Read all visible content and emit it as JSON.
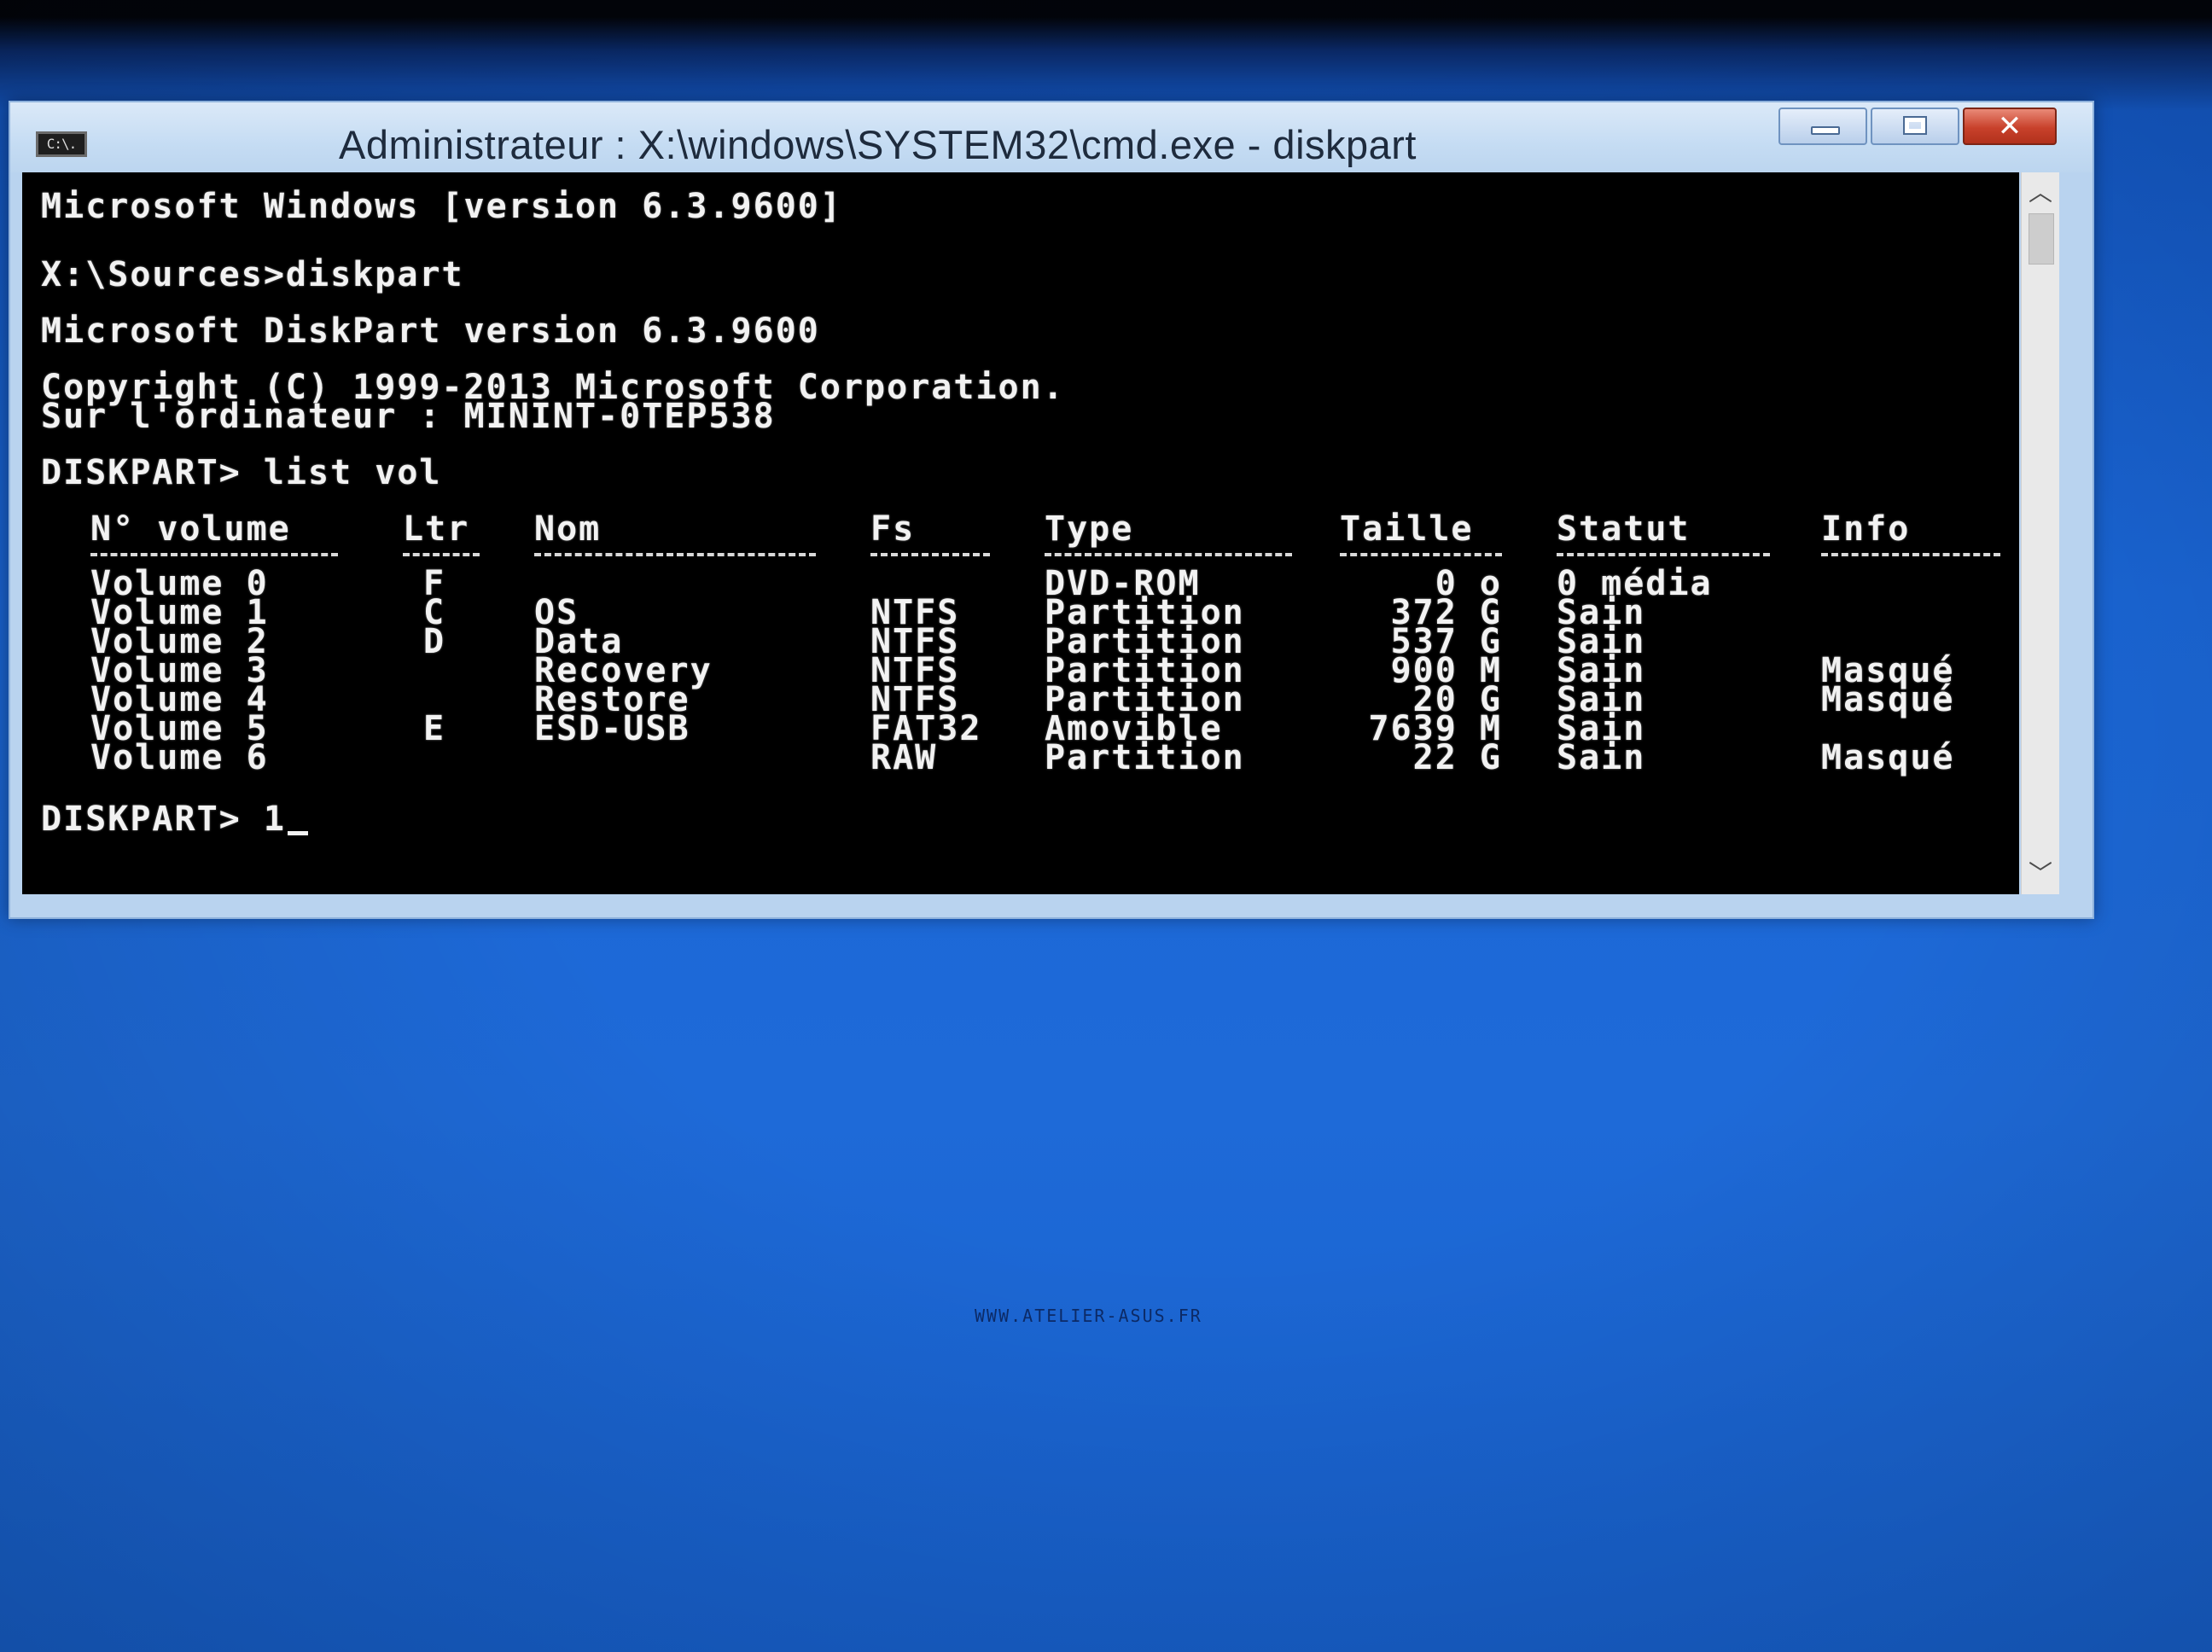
{
  "window": {
    "title": "Administrateur : X:\\windows\\SYSTEM32\\cmd.exe - diskpart",
    "icon_label": "C:\\."
  },
  "console": {
    "lines": [
      "Microsoft Windows [version 6.3.9600]",
      "X:\\Sources>diskpart",
      "Microsoft DiskPart version 6.3.9600",
      "Copyright (C) 1999-2013 Microsoft Corporation.",
      "Sur l'ordinateur : MININT-0TEP538",
      "DISKPART> list vol"
    ],
    "prompt": "DISKPART> ",
    "current_input": "1"
  },
  "volume_table": {
    "headers": [
      "N° volume",
      "Ltr",
      "Nom",
      "Fs",
      "Type",
      "Taille",
      "Statut",
      "Info"
    ],
    "rows": [
      {
        "volume": "Volume 0",
        "ltr": "F",
        "nom": "",
        "fs": "",
        "type": "DVD-ROM",
        "taille": "0 o",
        "statut": "0 média",
        "info": ""
      },
      {
        "volume": "Volume 1",
        "ltr": "C",
        "nom": "OS",
        "fs": "NTFS",
        "type": "Partition",
        "taille": "372 G",
        "statut": "Sain",
        "info": ""
      },
      {
        "volume": "Volume 2",
        "ltr": "D",
        "nom": "Data",
        "fs": "NTFS",
        "type": "Partition",
        "taille": "537 G",
        "statut": "Sain",
        "info": ""
      },
      {
        "volume": "Volume 3",
        "ltr": "",
        "nom": "Recovery",
        "fs": "NTFS",
        "type": "Partition",
        "taille": "900 M",
        "statut": "Sain",
        "info": "Masqué"
      },
      {
        "volume": "Volume 4",
        "ltr": "",
        "nom": "Restore",
        "fs": "NTFS",
        "type": "Partition",
        "taille": "20 G",
        "statut": "Sain",
        "info": "Masqué"
      },
      {
        "volume": "Volume 5",
        "ltr": "E",
        "nom": "ESD-USB",
        "fs": "FAT32",
        "type": "Amovible",
        "taille": "7639 M",
        "statut": "Sain",
        "info": ""
      },
      {
        "volume": "Volume 6",
        "ltr": "",
        "nom": "",
        "fs": "RAW",
        "type": "Partition",
        "taille": "22 G",
        "statut": "Sain",
        "info": "Masqué"
      }
    ]
  },
  "desktop": {
    "watermark": "WWW.ATELIER-ASUS.FR"
  },
  "colors": {
    "desktop_blue": "#1a66d6",
    "console_bg": "#000000",
    "console_fg": "#f2f2f2",
    "close_button": "#c8412b"
  },
  "icons": {
    "minimize": "minimize-icon",
    "maximize": "maximize-icon",
    "close": "close-icon",
    "scroll_up": "chevron-up-icon",
    "scroll_down": "chevron-down-icon"
  }
}
